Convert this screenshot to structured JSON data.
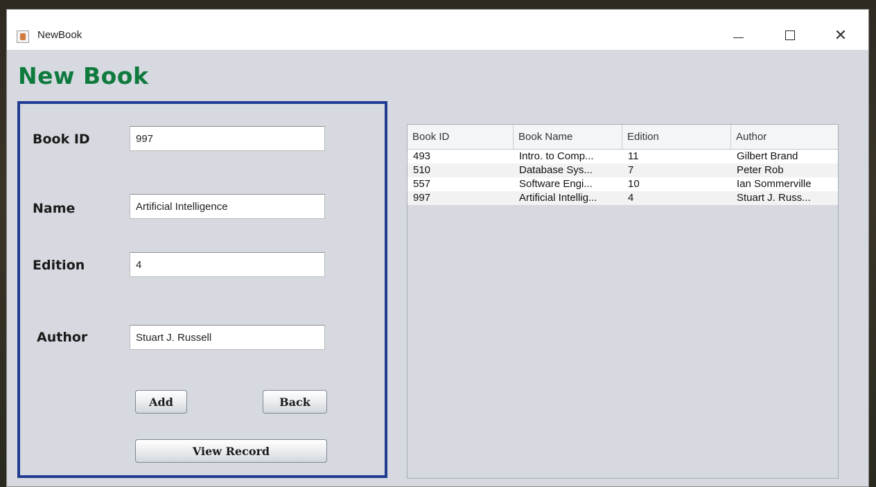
{
  "window": {
    "title": "NewBook",
    "min_glyph": "—",
    "close_glyph": "✕"
  },
  "heading": "New Book",
  "form": {
    "book_id_label": "Book ID",
    "book_id_value": "997",
    "name_label": "Name",
    "name_value": "Artificial Intelligence",
    "edition_label": "Edition",
    "edition_value": "4",
    "author_label": "Author",
    "author_value": "Stuart J. Russell",
    "add_label": "Add",
    "back_label": "Back",
    "view_record_label": "View Record"
  },
  "table": {
    "columns": [
      "Book ID",
      "Book Name",
      "Edition",
      "Author"
    ],
    "rows": [
      [
        "493",
        "Intro. to Comp...",
        "11",
        "Gilbert Brand"
      ],
      [
        "510",
        "Database Sys...",
        "7",
        "Peter Rob"
      ],
      [
        "557",
        "Software Engi...",
        "10",
        "Ian Sommerville"
      ],
      [
        "997",
        "Artificial Intellig...",
        "4",
        "Stuart J. Russ..."
      ]
    ]
  },
  "colors": {
    "heading": "#0f7a3e",
    "panel_border": "#1f3c92"
  },
  "icons": [
    "java-app-icon",
    "minimize-icon",
    "maximize-icon",
    "close-icon"
  ]
}
